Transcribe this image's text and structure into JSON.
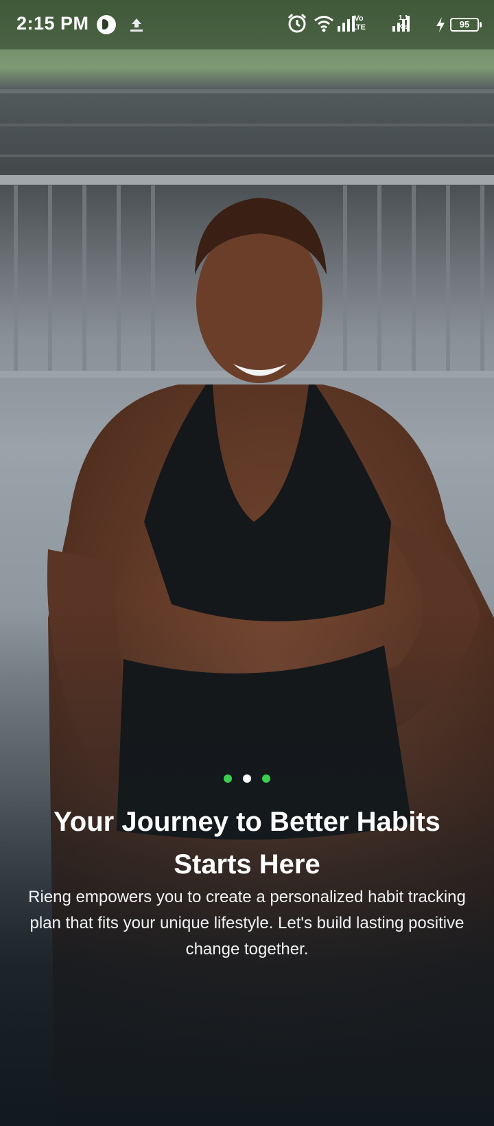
{
  "status_bar": {
    "time": "2:15 PM",
    "lte_label": "Vo LTE",
    "net_speed": "1.1 K/s",
    "battery": "95",
    "icons": [
      "app-icon",
      "upload-icon",
      "alarm-icon",
      "wifi-icon",
      "signal-icon",
      "lte-icon",
      "signal-icon",
      "charging-icon",
      "battery-icon"
    ]
  },
  "onboarding": {
    "pager": {
      "count": 3,
      "active_index": 1
    },
    "title": "Your Journey to Better Habits Starts Here",
    "description": "Rieng empowers you to create a personalized habit tracking plan that fits your unique lifestyle. Let's build lasting positive change together."
  },
  "colors": {
    "dot_active": "#ffffff",
    "dot_inactive": "#3ccf4e",
    "text": "#ffffff"
  }
}
